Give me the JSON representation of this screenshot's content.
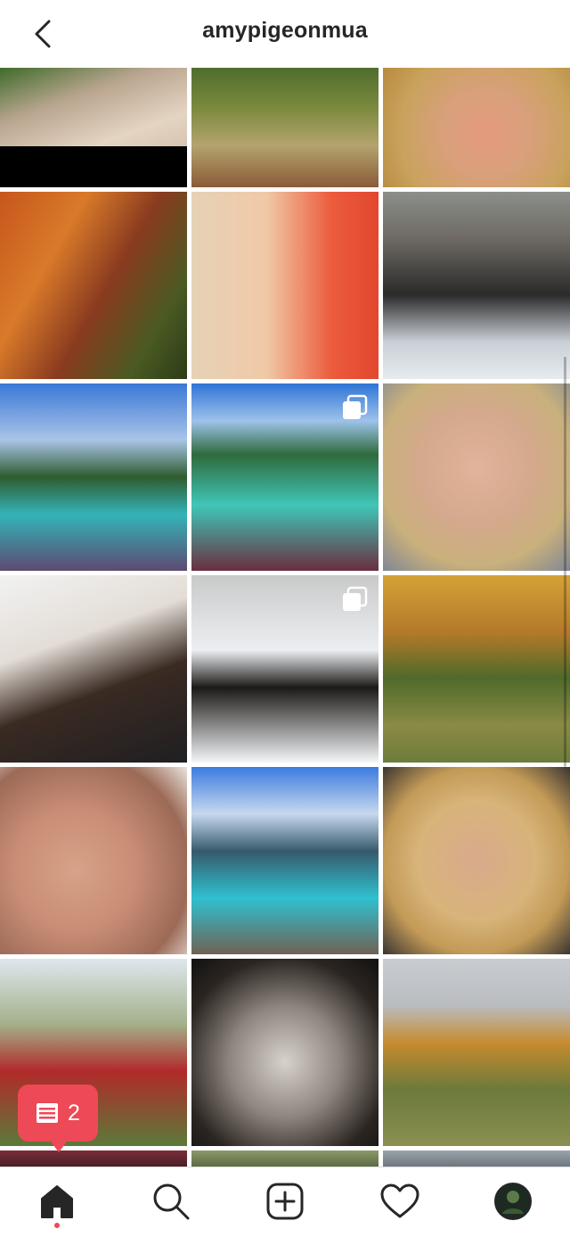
{
  "header": {
    "username": "amypigeonmua"
  },
  "notifications": {
    "count": "2"
  },
  "grid": {
    "tiles": [
      {
        "name": "tile-face-paint-eye",
        "bg": "linear-gradient(160deg,#3f6b2a 0%,#b9a58f 30%,#e4d4c2 60%,#c7b29c 100%)"
      },
      {
        "name": "tile-white-dress-forest",
        "bg": "linear-gradient(180deg,#4f6d2d 0%,#7d8b3f 35%,#b4a36d 65%,#8a5b38 100%)"
      },
      {
        "name": "tile-closeup-pink-lips",
        "bg": "radial-gradient(circle at 55% 55%,#e49a7c 0%,#d9a07c 35%,#c9a25d 70%,#b88a3e 100%)"
      },
      {
        "name": "tile-autumn-plaid-portrait",
        "bg": "linear-gradient(120deg,#c6561c 0%,#d97a2a 30%,#8a3b1f 55%,#4a5a22 80%,#2c3b18 100%)"
      },
      {
        "name": "tile-orange-bg-brush",
        "bg": "linear-gradient(90deg,#e6d2b7 0%,#f0c9a6 40%,#ec5b3c 75%,#e2472f 100%)"
      },
      {
        "name": "tile-ice-rink-dog",
        "bg": "linear-gradient(180deg,#8c8f8a 0%,#6e6a63 25%,#2a2a2a 55%,#c9cfd6 80%,#e7ebef 100%)"
      },
      {
        "name": "tile-lake-sunglasses",
        "bg": "linear-gradient(180deg,#3a78d6 0%,#a9c4e8 30%,#2f5c2e 50%,#34b3b8 70%,#5d4a72 100%)"
      },
      {
        "name": "tile-lake-smile",
        "bg": "linear-gradient(180deg,#2f74d6 0%,#9dc2ea 20%,#2f6a3b 38%,#3fc6b8 65%,#6b2e3f 100%)"
      },
      {
        "name": "tile-red-lips-closeup",
        "bg": "radial-gradient(circle at 50% 45%,#e2b49b 0%,#d4a98d 40%,#c9b07c 70%,#7f8794 100%)"
      },
      {
        "name": "tile-puppy-hug",
        "bg": "linear-gradient(160deg,#f2f2f2 0%,#e3ddd6 35%,#3a2a22 60%,#1f1f22 100%)"
      },
      {
        "name": "tile-puppy-snow",
        "bg": "linear-gradient(180deg,#c9c9c9 0%,#eceff2 40%,#1c1917 60%,#f4f6f8 100%)"
      },
      {
        "name": "tile-autumn-field-dog",
        "bg": "linear-gradient(180deg,#d4a237 0%,#b57a2a 30%,#4f6a2a 55%,#8a8a45 80%,#6d7d3a 100%)"
      },
      {
        "name": "tile-smokey-eye",
        "bg": "radial-gradient(circle at 40% 55%,#d6a288 0%,#c98d75 40%,#9c6a57 75%,#e9e3dd 100%)"
      },
      {
        "name": "tile-dock-lake",
        "bg": "linear-gradient(180deg,#3b7be0 0%,#c7d8ee 25%,#355a6c 45%,#2fc0d0 70%,#6e6254 100%)"
      },
      {
        "name": "tile-curls-portrait",
        "bg": "radial-gradient(circle at 50% 50%,#d9aa8c 0%,#d7b47a 45%,#c39a57 70%,#3a3531 100%)"
      },
      {
        "name": "tile-plaid-fence",
        "bg": "linear-gradient(180deg,#dfe7ee 0%,#a3b08a 35%,#b12a2a 60%,#5b7a39 100%)"
      },
      {
        "name": "tile-skull-makeup",
        "bg": "radial-gradient(circle at 50% 55%,#d8d2cc 0%,#8d857e 40%,#2b2521 75%,#111 100%)"
      },
      {
        "name": "tile-city-hill-dog",
        "bg": "linear-gradient(180deg,#c9ccd0 0%,#b9bcc0 25%,#c68b2f 45%,#6b7a3a 70%,#8b8f52 100%)"
      },
      {
        "name": "tile-partial-1",
        "bg": "linear-gradient(180deg,#7a2d3a,#4a1f26)"
      },
      {
        "name": "tile-partial-2",
        "bg": "linear-gradient(180deg,#8a9a6a,#5d6a45)"
      },
      {
        "name": "tile-partial-3",
        "bg": "linear-gradient(180deg,#9aa3ab,#6f777e)"
      }
    ]
  }
}
